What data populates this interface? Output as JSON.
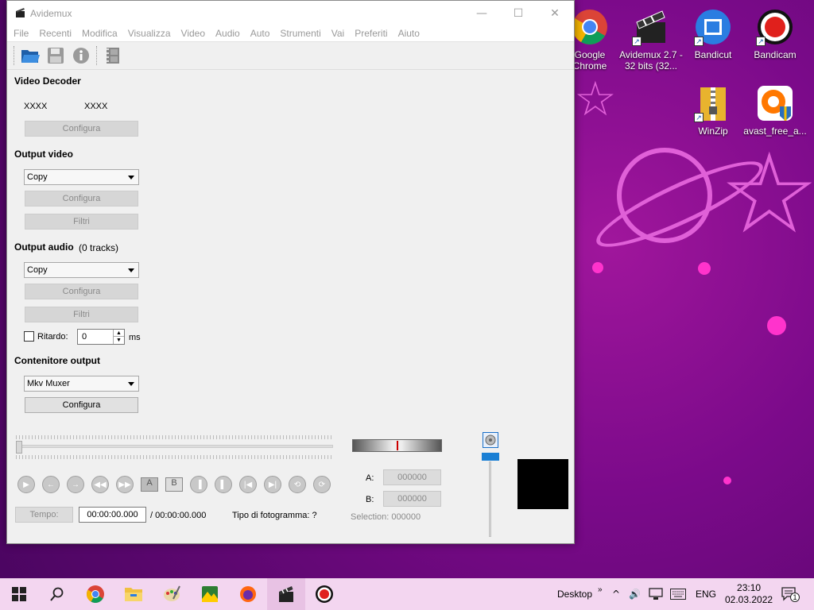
{
  "window": {
    "title": "Avidemux",
    "controls": {
      "minimize": "—",
      "maximize": "☐",
      "close": "✕"
    }
  },
  "menu": [
    "File",
    "Recenti",
    "Modifica",
    "Visualizza",
    "Video",
    "Audio",
    "Auto",
    "Strumenti",
    "Vai",
    "Preferiti",
    "Aiuto"
  ],
  "video_decoder": {
    "title": "Video Decoder",
    "codec_a": "XXXX",
    "codec_b": "XXXX",
    "configure": "Configura"
  },
  "output_video": {
    "title": "Output video",
    "codec": "Copy",
    "configure": "Configura",
    "filters": "Filtri"
  },
  "output_audio": {
    "title": "Output audio",
    "tracks": "(0 tracks)",
    "codec": "Copy",
    "configure": "Configura",
    "filters": "Filtri",
    "delay_label": "Ritardo:",
    "delay_value": "0",
    "delay_unit": "ms"
  },
  "container": {
    "title": "Contenitore output",
    "muxer": "Mkv Muxer",
    "configure": "Configura"
  },
  "navigation": {
    "markers": {
      "a_label": "A:",
      "a_value": "000000",
      "b_label": "B:",
      "b_value": "000000",
      "selection": "Selection: 000000"
    },
    "time_button": "Tempo:",
    "time_value": "00:00:00.000",
    "total_time": "/ 00:00:00.000",
    "frame_type": "Tipo di fotogramma:  ?"
  },
  "desktop_icons": [
    {
      "label": "Google Chrome",
      "icon": "chrome-icon"
    },
    {
      "label": "Avidemux 2.7 - 32 bits (32...",
      "icon": "avidemux-icon"
    },
    {
      "label": "Bandicut",
      "icon": "bandicut-icon"
    },
    {
      "label": "Bandicam",
      "icon": "bandicam-icon"
    },
    {
      "label": "WinZip",
      "icon": "winzip-icon"
    },
    {
      "label": "avast_free_a...",
      "icon": "avast-icon"
    }
  ],
  "taskbar": {
    "desktop_label": "Desktop",
    "language": "ENG",
    "time": "23:10",
    "date": "02.03.2022",
    "notification_count": "1"
  }
}
